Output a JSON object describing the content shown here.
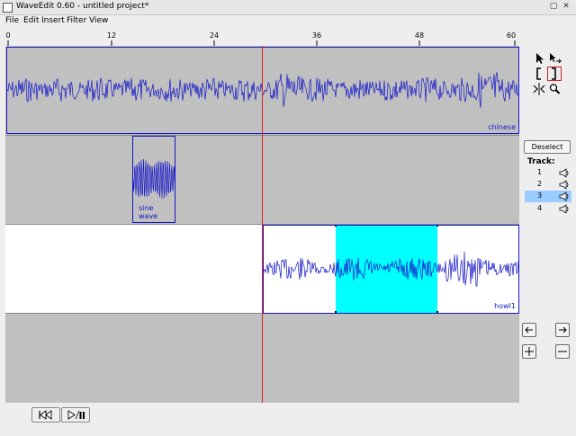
{
  "window": {
    "title": "WaveEdit 0.60 - untitled project*"
  },
  "menu": [
    "File",
    "Edit",
    "Insert",
    "Filter",
    "View"
  ],
  "ruler": {
    "ticks": [
      "0",
      "12",
      "24",
      "36",
      "48",
      "60"
    ]
  },
  "clips": {
    "chinese": "chinese",
    "sine": "sine wave",
    "howl": "howl1"
  },
  "sidebar": {
    "tools": [
      "pointer-icon",
      "move-tool-icon",
      "select-start-icon",
      "select-end-icon",
      "split-icon",
      "zoom-icon"
    ],
    "deselect_label": "Deselect",
    "track_label": "Track:",
    "tracks": [
      "1",
      "2",
      "3",
      "4"
    ],
    "selected_track": "3"
  },
  "colors": {
    "waveform": "#1515c8",
    "playhead": "#e02020",
    "selection": "#00ffff",
    "track_bg": "#c0c0c0",
    "selected_track_bg": "#ffffff",
    "selected_track_row": "#99ccff"
  }
}
